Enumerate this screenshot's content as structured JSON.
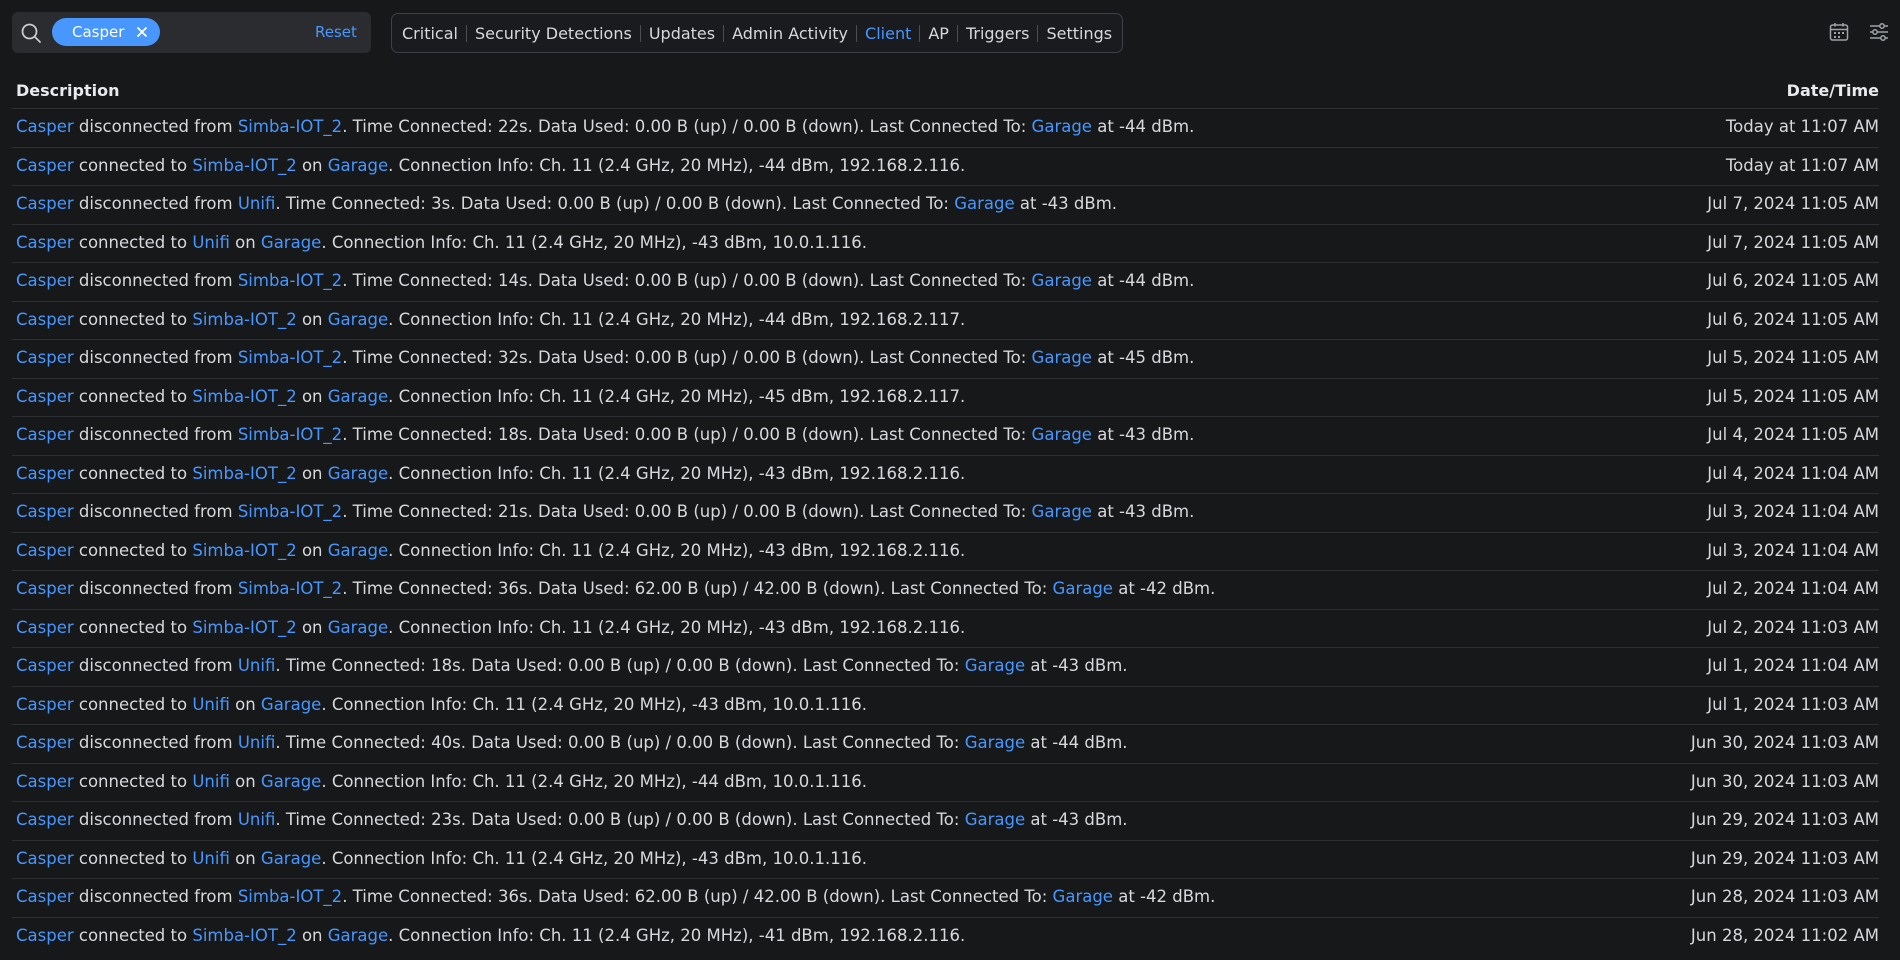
{
  "search": {
    "chip_label": "Casper",
    "reset_label": "Reset"
  },
  "tabs": [
    {
      "label": "Critical"
    },
    {
      "label": "Security Detections"
    },
    {
      "label": "Updates"
    },
    {
      "label": "Admin Activity"
    },
    {
      "label": "Client",
      "active": true
    },
    {
      "label": "AP"
    },
    {
      "label": "Triggers"
    },
    {
      "label": "Settings"
    }
  ],
  "icons": {
    "calendar": "calendar-icon",
    "filter": "sliders-icon",
    "search": "search-icon"
  },
  "colors": {
    "accent": "#4797ff",
    "background": "#17181a"
  },
  "table": {
    "headers": {
      "description": "Description",
      "datetime": "Date/Time"
    },
    "rows": [
      {
        "type": "disc",
        "client": "Casper",
        "ssid": "Simba-IOT_2",
        "tc": "22s",
        "up": "0.00 B",
        "down": "0.00 B",
        "ap": "Garage",
        "dbm": "-44",
        "date": "Today at 11:07 AM"
      },
      {
        "type": "conn",
        "client": "Casper",
        "ssid": "Simba-IOT_2",
        "ap": "Garage",
        "dbm": "-44",
        "ip": "192.168.2.116",
        "date": "Today at 11:07 AM"
      },
      {
        "type": "disc",
        "client": "Casper",
        "ssid": "Unifi",
        "tc": "3s",
        "up": "0.00 B",
        "down": "0.00 B",
        "ap": "Garage",
        "dbm": "-43",
        "date": "Jul 7, 2024 11:05 AM"
      },
      {
        "type": "conn",
        "client": "Casper",
        "ssid": "Unifi",
        "ap": "Garage",
        "dbm": "-43",
        "ip": "10.0.1.116",
        "date": "Jul 7, 2024 11:05 AM"
      },
      {
        "type": "disc",
        "client": "Casper",
        "ssid": "Simba-IOT_2",
        "tc": "14s",
        "up": "0.00 B",
        "down": "0.00 B",
        "ap": "Garage",
        "dbm": "-44",
        "date": "Jul 6, 2024 11:05 AM"
      },
      {
        "type": "conn",
        "client": "Casper",
        "ssid": "Simba-IOT_2",
        "ap": "Garage",
        "dbm": "-44",
        "ip": "192.168.2.117",
        "date": "Jul 6, 2024 11:05 AM"
      },
      {
        "type": "disc",
        "client": "Casper",
        "ssid": "Simba-IOT_2",
        "tc": "32s",
        "up": "0.00 B",
        "down": "0.00 B",
        "ap": "Garage",
        "dbm": "-45",
        "date": "Jul 5, 2024 11:05 AM"
      },
      {
        "type": "conn",
        "client": "Casper",
        "ssid": "Simba-IOT_2",
        "ap": "Garage",
        "dbm": "-45",
        "ip": "192.168.2.117",
        "date": "Jul 5, 2024 11:05 AM"
      },
      {
        "type": "disc",
        "client": "Casper",
        "ssid": "Simba-IOT_2",
        "tc": "18s",
        "up": "0.00 B",
        "down": "0.00 B",
        "ap": "Garage",
        "dbm": "-43",
        "date": "Jul 4, 2024 11:05 AM"
      },
      {
        "type": "conn",
        "client": "Casper",
        "ssid": "Simba-IOT_2",
        "ap": "Garage",
        "dbm": "-43",
        "ip": "192.168.2.116",
        "date": "Jul 4, 2024 11:04 AM"
      },
      {
        "type": "disc",
        "client": "Casper",
        "ssid": "Simba-IOT_2",
        "tc": "21s",
        "up": "0.00 B",
        "down": "0.00 B",
        "ap": "Garage",
        "dbm": "-43",
        "date": "Jul 3, 2024 11:04 AM"
      },
      {
        "type": "conn",
        "client": "Casper",
        "ssid": "Simba-IOT_2",
        "ap": "Garage",
        "dbm": "-43",
        "ip": "192.168.2.116",
        "date": "Jul 3, 2024 11:04 AM"
      },
      {
        "type": "disc",
        "client": "Casper",
        "ssid": "Simba-IOT_2",
        "tc": "36s",
        "up": "62.00 B",
        "down": "42.00 B",
        "ap": "Garage",
        "dbm": "-42",
        "date": "Jul 2, 2024 11:04 AM"
      },
      {
        "type": "conn",
        "client": "Casper",
        "ssid": "Simba-IOT_2",
        "ap": "Garage",
        "dbm": "-43",
        "ip": "192.168.2.116",
        "date": "Jul 2, 2024 11:03 AM"
      },
      {
        "type": "disc",
        "client": "Casper",
        "ssid": "Unifi",
        "tc": "18s",
        "up": "0.00 B",
        "down": "0.00 B",
        "ap": "Garage",
        "dbm": "-43",
        "date": "Jul 1, 2024 11:04 AM"
      },
      {
        "type": "conn",
        "client": "Casper",
        "ssid": "Unifi",
        "ap": "Garage",
        "dbm": "-43",
        "ip": "10.0.1.116",
        "date": "Jul 1, 2024 11:03 AM"
      },
      {
        "type": "disc",
        "client": "Casper",
        "ssid": "Unifi",
        "tc": "40s",
        "up": "0.00 B",
        "down": "0.00 B",
        "ap": "Garage",
        "dbm": "-44",
        "date": "Jun 30, 2024 11:03 AM"
      },
      {
        "type": "conn",
        "client": "Casper",
        "ssid": "Unifi",
        "ap": "Garage",
        "dbm": "-44",
        "ip": "10.0.1.116",
        "date": "Jun 30, 2024 11:03 AM"
      },
      {
        "type": "disc",
        "client": "Casper",
        "ssid": "Unifi",
        "tc": "23s",
        "up": "0.00 B",
        "down": "0.00 B",
        "ap": "Garage",
        "dbm": "-43",
        "date": "Jun 29, 2024 11:03 AM"
      },
      {
        "type": "conn",
        "client": "Casper",
        "ssid": "Unifi",
        "ap": "Garage",
        "dbm": "-43",
        "ip": "10.0.1.116",
        "date": "Jun 29, 2024 11:03 AM"
      },
      {
        "type": "disc",
        "client": "Casper",
        "ssid": "Simba-IOT_2",
        "tc": "36s",
        "up": "62.00 B",
        "down": "42.00 B",
        "ap": "Garage",
        "dbm": "-42",
        "date": "Jun 28, 2024 11:03 AM"
      },
      {
        "type": "conn",
        "client": "Casper",
        "ssid": "Simba-IOT_2",
        "ap": "Garage",
        "dbm": "-41",
        "ip": "192.168.2.116",
        "date": "Jun 28, 2024 11:02 AM"
      }
    ]
  }
}
